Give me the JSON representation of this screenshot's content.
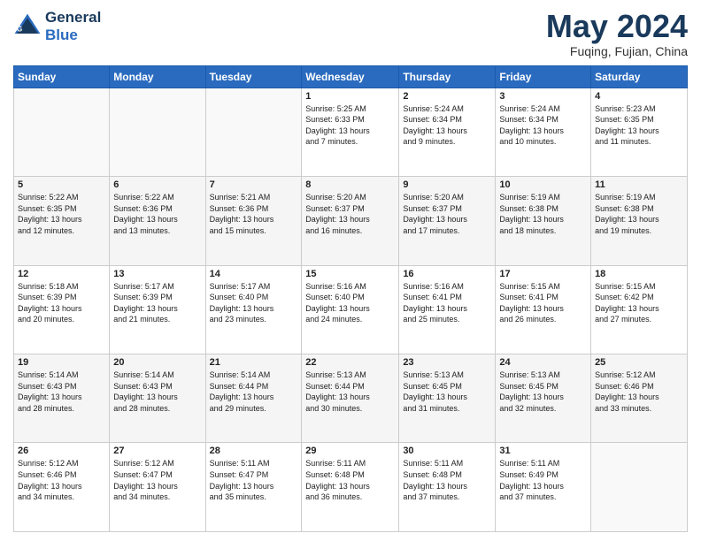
{
  "header": {
    "logo_line1": "General",
    "logo_line2": "Blue",
    "month": "May 2024",
    "location": "Fuqing, Fujian, China"
  },
  "days_of_week": [
    "Sunday",
    "Monday",
    "Tuesday",
    "Wednesday",
    "Thursday",
    "Friday",
    "Saturday"
  ],
  "weeks": [
    [
      {
        "day": "",
        "info": ""
      },
      {
        "day": "",
        "info": ""
      },
      {
        "day": "",
        "info": ""
      },
      {
        "day": "1",
        "info": "Sunrise: 5:25 AM\nSunset: 6:33 PM\nDaylight: 13 hours\nand 7 minutes."
      },
      {
        "day": "2",
        "info": "Sunrise: 5:24 AM\nSunset: 6:34 PM\nDaylight: 13 hours\nand 9 minutes."
      },
      {
        "day": "3",
        "info": "Sunrise: 5:24 AM\nSunset: 6:34 PM\nDaylight: 13 hours\nand 10 minutes."
      },
      {
        "day": "4",
        "info": "Sunrise: 5:23 AM\nSunset: 6:35 PM\nDaylight: 13 hours\nand 11 minutes."
      }
    ],
    [
      {
        "day": "5",
        "info": "Sunrise: 5:22 AM\nSunset: 6:35 PM\nDaylight: 13 hours\nand 12 minutes."
      },
      {
        "day": "6",
        "info": "Sunrise: 5:22 AM\nSunset: 6:36 PM\nDaylight: 13 hours\nand 13 minutes."
      },
      {
        "day": "7",
        "info": "Sunrise: 5:21 AM\nSunset: 6:36 PM\nDaylight: 13 hours\nand 15 minutes."
      },
      {
        "day": "8",
        "info": "Sunrise: 5:20 AM\nSunset: 6:37 PM\nDaylight: 13 hours\nand 16 minutes."
      },
      {
        "day": "9",
        "info": "Sunrise: 5:20 AM\nSunset: 6:37 PM\nDaylight: 13 hours\nand 17 minutes."
      },
      {
        "day": "10",
        "info": "Sunrise: 5:19 AM\nSunset: 6:38 PM\nDaylight: 13 hours\nand 18 minutes."
      },
      {
        "day": "11",
        "info": "Sunrise: 5:19 AM\nSunset: 6:38 PM\nDaylight: 13 hours\nand 19 minutes."
      }
    ],
    [
      {
        "day": "12",
        "info": "Sunrise: 5:18 AM\nSunset: 6:39 PM\nDaylight: 13 hours\nand 20 minutes."
      },
      {
        "day": "13",
        "info": "Sunrise: 5:17 AM\nSunset: 6:39 PM\nDaylight: 13 hours\nand 21 minutes."
      },
      {
        "day": "14",
        "info": "Sunrise: 5:17 AM\nSunset: 6:40 PM\nDaylight: 13 hours\nand 23 minutes."
      },
      {
        "day": "15",
        "info": "Sunrise: 5:16 AM\nSunset: 6:40 PM\nDaylight: 13 hours\nand 24 minutes."
      },
      {
        "day": "16",
        "info": "Sunrise: 5:16 AM\nSunset: 6:41 PM\nDaylight: 13 hours\nand 25 minutes."
      },
      {
        "day": "17",
        "info": "Sunrise: 5:15 AM\nSunset: 6:41 PM\nDaylight: 13 hours\nand 26 minutes."
      },
      {
        "day": "18",
        "info": "Sunrise: 5:15 AM\nSunset: 6:42 PM\nDaylight: 13 hours\nand 27 minutes."
      }
    ],
    [
      {
        "day": "19",
        "info": "Sunrise: 5:14 AM\nSunset: 6:43 PM\nDaylight: 13 hours\nand 28 minutes."
      },
      {
        "day": "20",
        "info": "Sunrise: 5:14 AM\nSunset: 6:43 PM\nDaylight: 13 hours\nand 28 minutes."
      },
      {
        "day": "21",
        "info": "Sunrise: 5:14 AM\nSunset: 6:44 PM\nDaylight: 13 hours\nand 29 minutes."
      },
      {
        "day": "22",
        "info": "Sunrise: 5:13 AM\nSunset: 6:44 PM\nDaylight: 13 hours\nand 30 minutes."
      },
      {
        "day": "23",
        "info": "Sunrise: 5:13 AM\nSunset: 6:45 PM\nDaylight: 13 hours\nand 31 minutes."
      },
      {
        "day": "24",
        "info": "Sunrise: 5:13 AM\nSunset: 6:45 PM\nDaylight: 13 hours\nand 32 minutes."
      },
      {
        "day": "25",
        "info": "Sunrise: 5:12 AM\nSunset: 6:46 PM\nDaylight: 13 hours\nand 33 minutes."
      }
    ],
    [
      {
        "day": "26",
        "info": "Sunrise: 5:12 AM\nSunset: 6:46 PM\nDaylight: 13 hours\nand 34 minutes."
      },
      {
        "day": "27",
        "info": "Sunrise: 5:12 AM\nSunset: 6:47 PM\nDaylight: 13 hours\nand 34 minutes."
      },
      {
        "day": "28",
        "info": "Sunrise: 5:11 AM\nSunset: 6:47 PM\nDaylight: 13 hours\nand 35 minutes."
      },
      {
        "day": "29",
        "info": "Sunrise: 5:11 AM\nSunset: 6:48 PM\nDaylight: 13 hours\nand 36 minutes."
      },
      {
        "day": "30",
        "info": "Sunrise: 5:11 AM\nSunset: 6:48 PM\nDaylight: 13 hours\nand 37 minutes."
      },
      {
        "day": "31",
        "info": "Sunrise: 5:11 AM\nSunset: 6:49 PM\nDaylight: 13 hours\nand 37 minutes."
      },
      {
        "day": "",
        "info": ""
      }
    ]
  ]
}
